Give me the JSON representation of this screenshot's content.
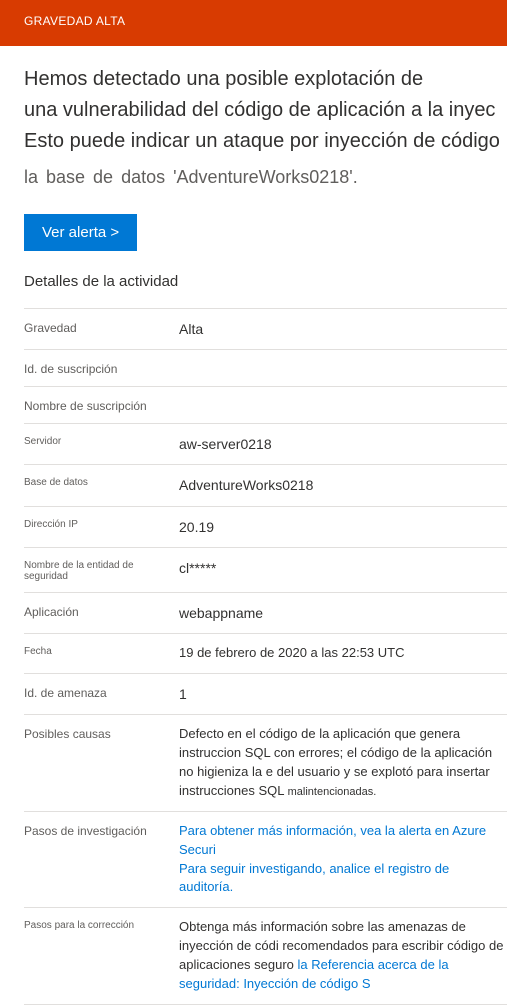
{
  "banner": {
    "severity_label": "GRAVEDAD ALTA"
  },
  "headline": {
    "line1": "Hemos detectado una posible explotación de",
    "line2": "una vulnerabilidad del código de aplicación a la inyec",
    "line3": "Esto puede indicar un ataque por inyección de código",
    "line4": "la  base  de  datos  'AdventureWorks0218'."
  },
  "cta": {
    "label": "Ver alerta   >"
  },
  "section": {
    "title": "Detalles de la actividad"
  },
  "rows": {
    "gravedad": {
      "k": "Gravedad",
      "v": "Alta"
    },
    "idsusc": {
      "k": "Id. de suscripción",
      "v": ""
    },
    "nomsusc": {
      "k": "Nombre de suscripción",
      "v": ""
    },
    "servidor": {
      "k": "Servidor",
      "v": "aw-server0218"
    },
    "basedatos": {
      "k": "Base de datos",
      "v": "AdventureWorks0218"
    },
    "ip": {
      "k": "Dirección IP",
      "v": "20.19"
    },
    "entidad": {
      "k": "Nombre de la entidad de seguridad",
      "v": "cl*****"
    },
    "app": {
      "k": "Aplicación",
      "v": "webappname"
    },
    "fecha": {
      "k": "Fecha",
      "v": "19 de febrero de 2020 a las 22:53 UTC"
    },
    "idamenaza": {
      "k": "Id. de amenaza",
      "v": "1"
    },
    "causas": {
      "k": "Posibles causas",
      "v_main": "Defecto en el código de la aplicación que genera instruccion SQL con errores; el código de la aplicación no higieniza la e del usuario y se explotó para insertar instrucciones SQL",
      "v_tail": "malintencionadas."
    },
    "pasos_inv": {
      "k": "Pasos de investigación",
      "v1": "Para obtener más información, vea la alerta en Azure Securi",
      "v2": "Para seguir investigando, analice el registro de auditoría."
    },
    "pasos_corr": {
      "k": "Pasos para la corrección",
      "v_plain": "Obtenga más información sobre las amenazas de inyección de códi recomendados para escribir código de aplicaciones seguro",
      "v_link": "la Referencia acerca de la seguridad: Inyección de código S"
    }
  }
}
